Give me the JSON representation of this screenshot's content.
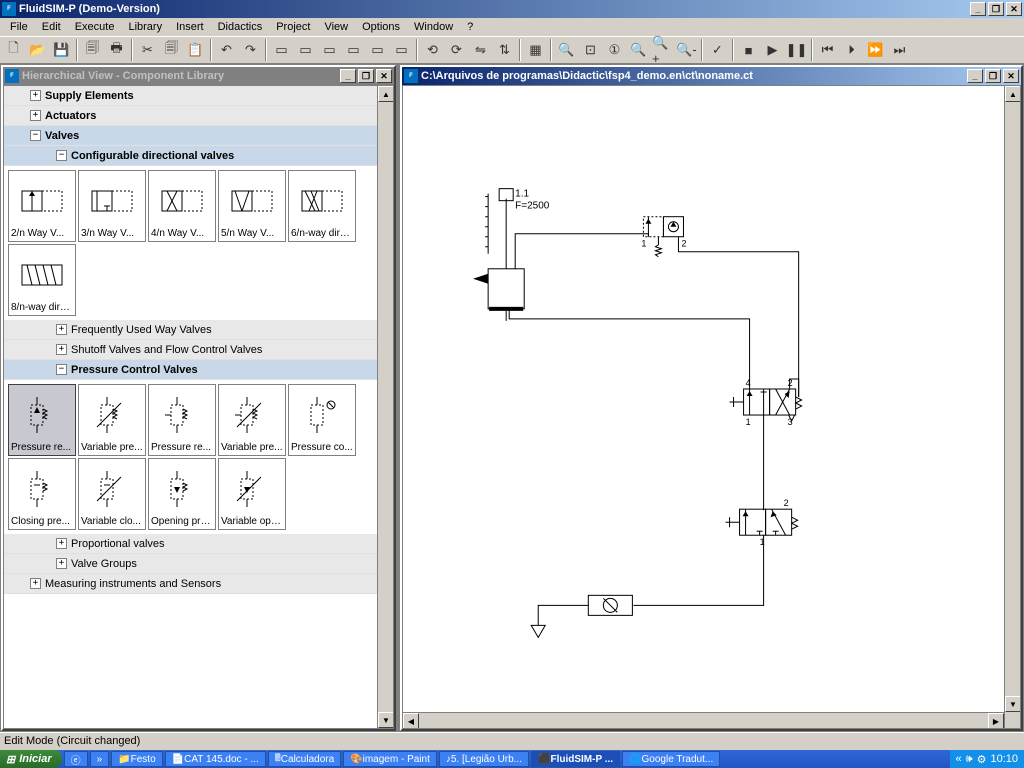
{
  "window": {
    "title": "FluidSIM-P (Demo-Version)"
  },
  "menu": [
    "File",
    "Edit",
    "Execute",
    "Library",
    "Insert",
    "Didactics",
    "Project",
    "View",
    "Options",
    "Window",
    "?"
  ],
  "panel_left": {
    "title": "Hierarchical View - Component Library"
  },
  "panel_right": {
    "title": "C:\\Arquivos de programas\\Didactic\\fsp4_demo.en\\ct\\noname.ct"
  },
  "tree": {
    "supply": "Supply Elements",
    "actuators": "Actuators",
    "valves": "Valves",
    "config_valves": "Configurable directional valves",
    "freq_way": "Frequently Used Way Valves",
    "shutoff": "Shutoff Valves and Flow Control Valves",
    "pressure_ctrl": "Pressure Control Valves",
    "proportional": "Proportional valves",
    "valve_groups": "Valve Groups",
    "measuring": "Measuring instruments and Sensors"
  },
  "comp_dir": {
    "2n": "2/n Way V...",
    "3n": "3/n Way V...",
    "4n": "4/n Way V...",
    "5n": "5/n Way V...",
    "6n": "6/n-way dire...",
    "8n": "8/n-way dire..."
  },
  "comp_press": {
    "pr_re": "Pressure re...",
    "var_pr": "Variable pre...",
    "pr_re2": "Pressure re...",
    "var_pr2": "Variable pre...",
    "pr_co": "Pressure co...",
    "cl_pr": "Closing pre...",
    "var_cl": "Variable clo...",
    "op_pr": "Opening pre...",
    "var_op": "Variable ope..."
  },
  "circuit_labels": {
    "cyl": "1.1",
    "force": "F=2500",
    "p1": "1",
    "p2": "2",
    "p3": "3",
    "p4": "4"
  },
  "status": "Edit Mode (Circuit changed)",
  "taskbar": {
    "start": "Iniciar",
    "items": [
      "Festo",
      "CAT 145.doc - ...",
      "Calculadora",
      "imagem - Paint",
      "5. [Legião Urb...",
      "FluidSIM-P ...",
      "Google Tradut..."
    ],
    "clock": "10:10"
  }
}
